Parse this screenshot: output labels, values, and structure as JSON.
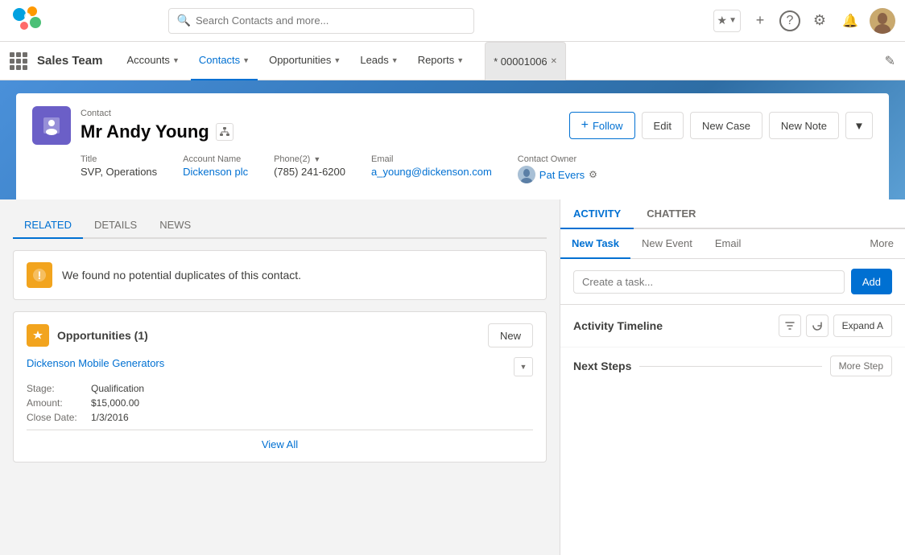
{
  "topnav": {
    "search_placeholder": "Search Contacts and more...",
    "star_icon": "★",
    "add_icon": "+",
    "help_icon": "?",
    "settings_icon": "⚙",
    "bell_icon": "🔔"
  },
  "appnav": {
    "app_name": "Sales Team",
    "nav_items": [
      {
        "label": "Accounts",
        "active": false
      },
      {
        "label": "Contacts",
        "active": true
      },
      {
        "label": "Opportunities",
        "active": false
      },
      {
        "label": "Leads",
        "active": false
      },
      {
        "label": "Reports",
        "active": false
      }
    ],
    "tab_label": "* 00001006",
    "edit_icon": "✎"
  },
  "contact": {
    "breadcrumb": "Contact",
    "name": "Mr Andy Young",
    "follow_label": "Follow",
    "edit_label": "Edit",
    "new_case_label": "New Case",
    "new_note_label": "New Note",
    "fields": {
      "title_label": "Title",
      "title_value": "SVP, Operations",
      "account_label": "Account Name",
      "account_value": "Dickenson plc",
      "phone_label": "Phone(2)",
      "phone_value": "(785) 241-6200",
      "email_label": "Email",
      "email_value": "a_young@dickenson.com",
      "owner_label": "Contact Owner",
      "owner_value": "Pat Evers"
    }
  },
  "left_panel": {
    "tabs": [
      {
        "label": "RELATED",
        "active": true
      },
      {
        "label": "DETAILS",
        "active": false
      },
      {
        "label": "NEWS",
        "active": false
      }
    ],
    "duplicate_notice": "We found no potential duplicates of this contact.",
    "opportunities": {
      "title": "Opportunities (1)",
      "new_btn": "New",
      "opp_name": "Dickenson Mobile Generators",
      "stage_label": "Stage:",
      "stage_value": "Qualification",
      "amount_label": "Amount:",
      "amount_value": "$15,000.00",
      "close_label": "Close Date:",
      "close_value": "1/3/2016",
      "view_all": "View All"
    }
  },
  "right_panel": {
    "tabs": [
      {
        "label": "ACTIVITY",
        "active": true
      },
      {
        "label": "CHATTER",
        "active": false
      }
    ],
    "activity_tabs": [
      {
        "label": "New Task",
        "active": true
      },
      {
        "label": "New Event",
        "active": false
      },
      {
        "label": "Email",
        "active": false
      },
      {
        "label": "More",
        "active": false
      }
    ],
    "task_placeholder": "Create a task...",
    "add_btn": "Add",
    "timeline_title": "Activity Timeline",
    "expand_btn": "Expand A",
    "next_steps_label": "Next Steps",
    "more_steps_btn": "More Step"
  }
}
